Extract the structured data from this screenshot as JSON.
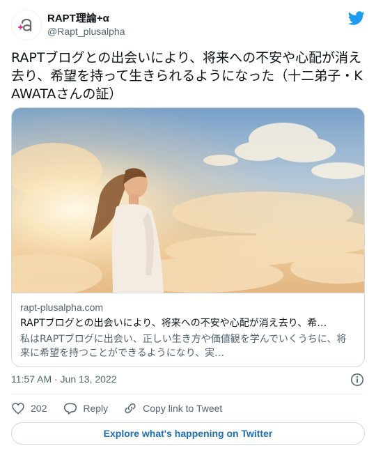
{
  "author": {
    "name": "RAPT理論+α",
    "handle": "@Rapt_plusalpha"
  },
  "tweet": {
    "text": "RAPTブログとの出会いにより、将来への不安や心配が消え去り、希望を持って生きられるようになった（十二弟子・KAWATAさんの証）"
  },
  "link_card": {
    "domain": "rapt-plusalpha.com",
    "title": "RAPTブログとの出会いにより、将来への不安や心配が消え去り、希…",
    "description": "私はRAPTブログに出会い、正しい生き方や価値観を学んでいくうちに、将来に希望を持つことができるようになり、実…"
  },
  "timestamp": "11:57 AM · Jun 13, 2022",
  "actions": {
    "like_count": "202",
    "reply_label": "Reply",
    "copy_label": "Copy link to Tweet"
  },
  "explore_label": "Explore what's happening on Twitter",
  "colors": {
    "twitter_blue": "#1d9bf0",
    "link_blue": "#1d6fb4",
    "secondary_text": "#536471",
    "border": "#cfd9de",
    "avatar_accent": "#e0338f"
  },
  "icons": {
    "logo": "twitter-bird-icon",
    "info": "info-icon",
    "like": "heart-icon",
    "reply": "reply-bubble-icon",
    "copy": "link-chain-icon"
  }
}
